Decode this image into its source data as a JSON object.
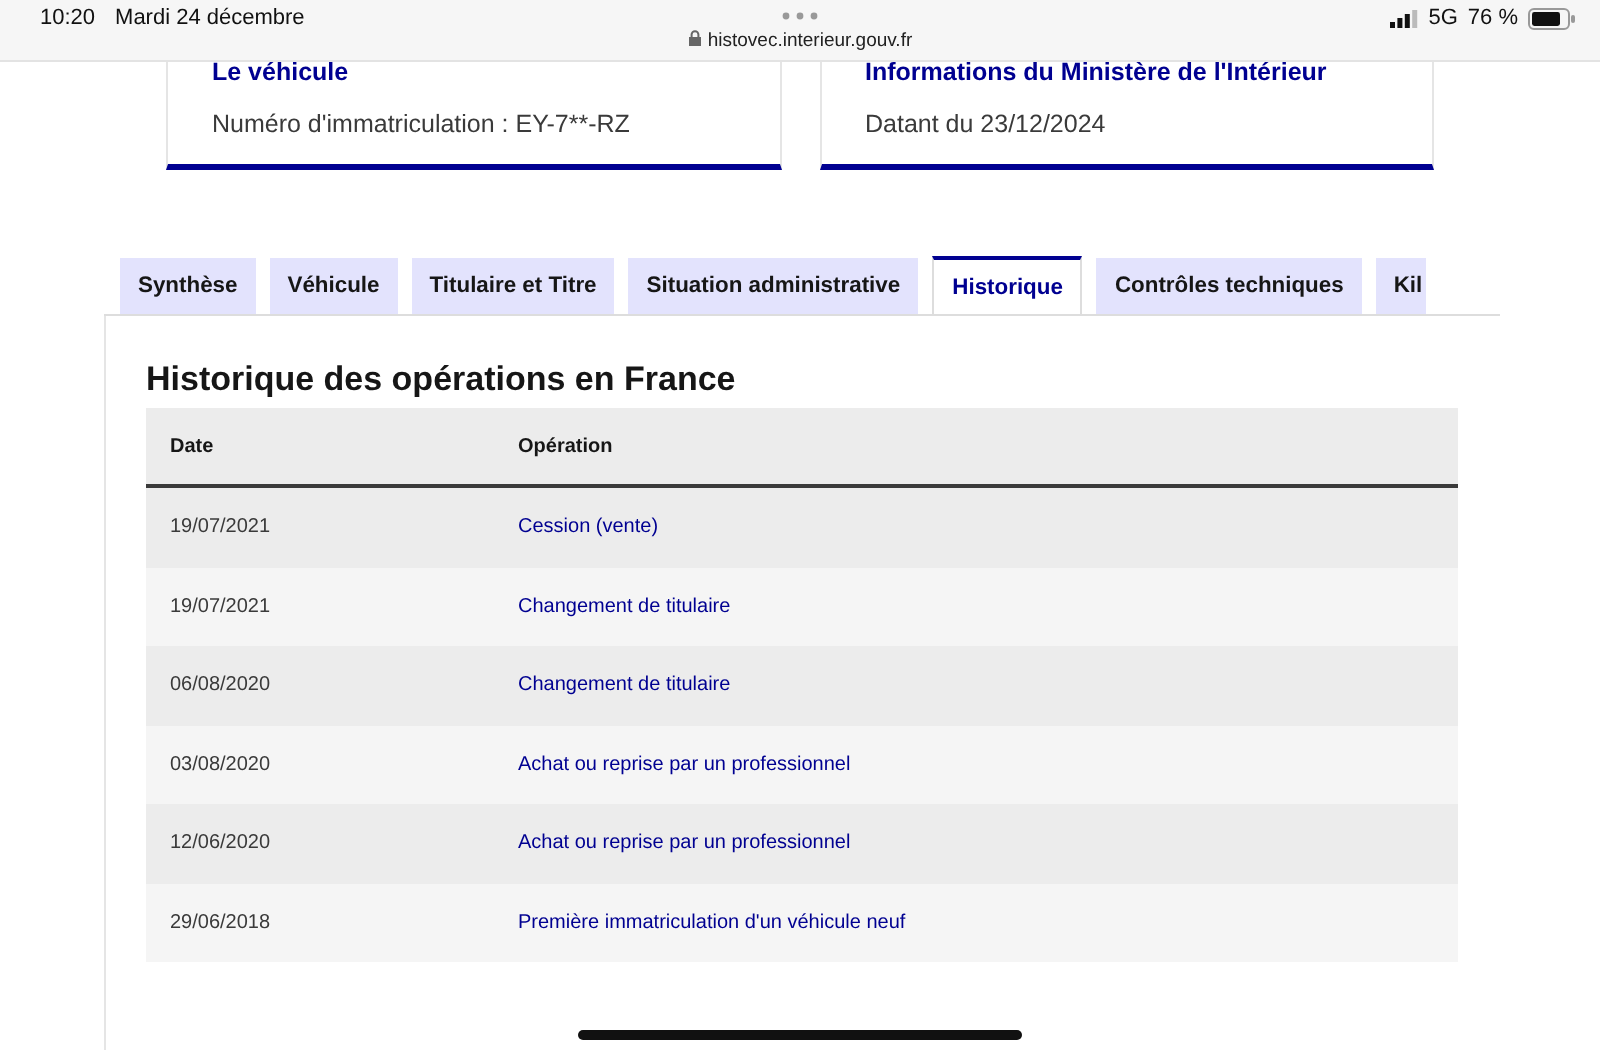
{
  "status_bar": {
    "time": "10:20",
    "date": "Mardi 24 décembre",
    "url": "histovec.interieur.gouv.fr",
    "network": "5G",
    "battery": "76 %"
  },
  "cards": [
    {
      "title": "Le véhicule",
      "text": "Numéro d'immatriculation : EY-7**-RZ"
    },
    {
      "title": "Informations du Ministère de l'Intérieur",
      "text": "Datant du 23/12/2024"
    }
  ],
  "tabs": [
    {
      "label": "Synthèse",
      "selected": false
    },
    {
      "label": "Véhicule",
      "selected": false
    },
    {
      "label": "Titulaire et Titre",
      "selected": false
    },
    {
      "label": "Situation administrative",
      "selected": false
    },
    {
      "label": "Historique",
      "selected": true
    },
    {
      "label": "Contrôles techniques",
      "selected": false
    },
    {
      "label": "Kil",
      "selected": false
    }
  ],
  "section": {
    "title": "Historique des opérations en France",
    "table": {
      "columns": [
        "Date",
        "Opération"
      ],
      "rows": [
        [
          "19/07/2021",
          "Cession (vente)"
        ],
        [
          "19/07/2021",
          "Changement de titulaire"
        ],
        [
          "06/08/2020",
          "Changement de titulaire"
        ],
        [
          "03/08/2020",
          "Achat ou reprise par un professionnel"
        ],
        [
          "12/06/2020",
          "Achat ou reprise par un professionnel"
        ],
        [
          "29/06/2018",
          "Première immatriculation d'un véhicule neuf"
        ]
      ]
    }
  }
}
